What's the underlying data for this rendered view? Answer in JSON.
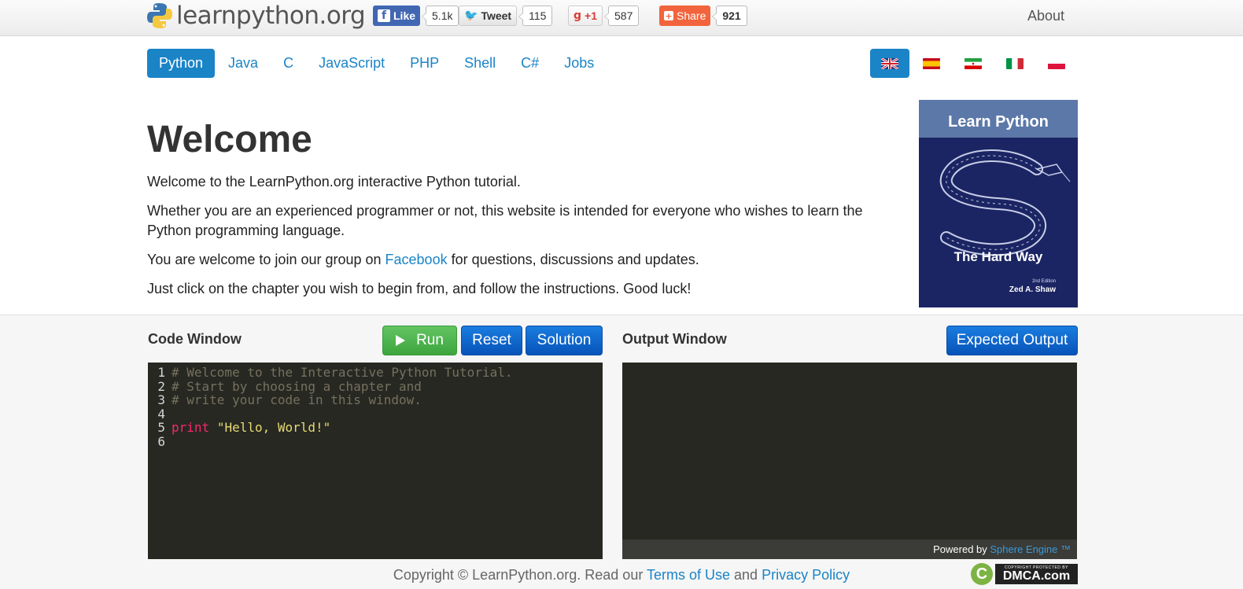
{
  "header": {
    "logo_text": "learnpython.org",
    "about": "About",
    "social": {
      "facebook": {
        "label": "Like",
        "count": "5.1k"
      },
      "twitter": {
        "label": "Tweet",
        "count": "115"
      },
      "gplus": {
        "label": "+1",
        "count": "587"
      },
      "share": {
        "label": "Share",
        "count": "921"
      }
    }
  },
  "nav": {
    "items": [
      "Python",
      "Java",
      "C",
      "JavaScript",
      "PHP",
      "Shell",
      "C#",
      "Jobs"
    ],
    "active": "Python"
  },
  "languages": [
    "English",
    "Spanish",
    "Persian",
    "Italian",
    "Polish"
  ],
  "welcome": {
    "title": "Welcome",
    "p1": "Welcome to the LearnPython.org interactive Python tutorial.",
    "p2": "Whether you are an experienced programmer or not, this website is intended for everyone who wishes to learn the Python programming language.",
    "p3_before": "You are welcome to join our group on ",
    "p3_link": "Facebook",
    "p3_after": " for questions, discussions and updates.",
    "p4": "Just click on the chapter you wish to begin from, and follow the instructions. Good luck!"
  },
  "book": {
    "title": "Learn Python",
    "subtitle": "The Hard Way",
    "edition": "2nd Edition",
    "author": "Zed A. Shaw"
  },
  "code_window": {
    "title": "Code Window",
    "run": "Run",
    "reset": "Reset",
    "solution": "Solution",
    "lines": [
      {
        "n": "1",
        "text": "# Welcome to the Interactive Python Tutorial.",
        "kind": "comment"
      },
      {
        "n": "2",
        "text": "# Start by choosing a chapter and",
        "kind": "comment"
      },
      {
        "n": "3",
        "text": "# write your code in this window.",
        "kind": "comment"
      },
      {
        "n": "4",
        "text": "",
        "kind": "blank"
      },
      {
        "n": "5",
        "keyword": "print",
        "string": "\"Hello, World!\"",
        "kind": "print"
      },
      {
        "n": "6",
        "text": "",
        "kind": "blank"
      }
    ]
  },
  "output_window": {
    "title": "Output Window",
    "expected": "Expected Output",
    "powered_by": "Powered by ",
    "engine": "Sphere Engine ™"
  },
  "footer": {
    "copyright": "Copyright © LearnPython.org. Read our ",
    "terms": "Terms of Use",
    "and": " and ",
    "privacy": "Privacy Policy",
    "dmca_small": "COPYRIGHT PROTECTED BY",
    "dmca_big": "DMCA.com"
  },
  "colors": {
    "accent": "#1a84c7",
    "run_green": "#3ea53e",
    "editor_bg": "#272822"
  }
}
